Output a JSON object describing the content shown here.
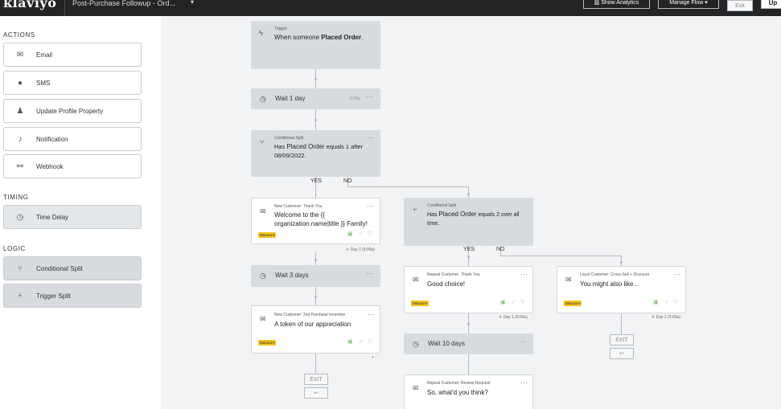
{
  "header": {
    "logo": "klaviyo",
    "flow_name": "Post-Purchase Followup - Ord...",
    "caret": "▾",
    "buttons": {
      "analytics": "▥ Show Analytics",
      "manage": "Manage Flow ▾",
      "exit": "Exit",
      "update": "Up"
    }
  },
  "sidebar": {
    "actions_title": "ACTIONS",
    "actions": [
      {
        "label": "Email",
        "icon": "envelope-icon"
      },
      {
        "label": "SMS",
        "icon": "chat-bubble-icon"
      },
      {
        "label": "Update Profile Property",
        "icon": "person-icon"
      },
      {
        "label": "Notification",
        "icon": "bell-icon"
      },
      {
        "label": "Webhook",
        "icon": "webhook-icon"
      }
    ],
    "timing_title": "TIMING",
    "timing": [
      {
        "label": "Time Delay",
        "icon": "clock-icon"
      }
    ],
    "logic_title": "LOGIC",
    "logic": [
      {
        "label": "Conditional Split",
        "icon": "split-icon"
      },
      {
        "label": "Trigger Split",
        "icon": "trigger-split-icon"
      }
    ]
  },
  "canvas": {
    "trigger": {
      "label": "Trigger",
      "text_pre": "When someone ",
      "text_bold": "Placed Order",
      "text_post": "."
    },
    "wait1": {
      "text": "Wait 1 day",
      "meta": "9:00a"
    },
    "split1": {
      "label": "Conditional Split",
      "text_pre": "Has ",
      "text_bold": "Placed Order",
      "text_post": " equals 1 after 08/09/2022."
    },
    "split1_yes": "YES",
    "split1_no": "NO",
    "email_thank": {
      "label": "New Customer: Thank You",
      "text": "Welcome to the {{ organization.name|title }} Family!",
      "badge": "Manual ▾",
      "delay": "✈ Day 1 (9:00a)"
    },
    "split2": {
      "label": "Conditional Split",
      "text_pre": "Has ",
      "text_bold": "Placed Order",
      "text_post": " equals 2 over all time."
    },
    "split2_yes": "YES",
    "split2_no": "NO",
    "wait3": {
      "text": "Wait 3 days"
    },
    "email_incentive": {
      "label": "New Customer: 2nd Purchase Incentive",
      "text": "A token of our appreciation",
      "badge": "Manual ▾",
      "plus": "+ -"
    },
    "exit_left": "EXIT",
    "email_repeat": {
      "label": "Repeat Customer: Thank You",
      "text": "Good choice!",
      "badge": "Manual ▾",
      "delay": "✈ Day 1 (9:00a)"
    },
    "email_loyal": {
      "label": "Loyal Customer: Cross-Sell + Discount",
      "text": "You might also like...",
      "badge": "Manual ▾",
      "delay": "✈ Day 1 (9:00a)"
    },
    "exit_right": "EXIT",
    "wait10": {
      "text": "Wait 10 days"
    },
    "email_review": {
      "label": "Repeat Customer: Review Request",
      "text": "So, what'd you think?"
    },
    "more": "···",
    "colors": {
      "topbar": "#232426",
      "badge": "#f0c419",
      "grey_node": "#d7dbe0"
    }
  }
}
